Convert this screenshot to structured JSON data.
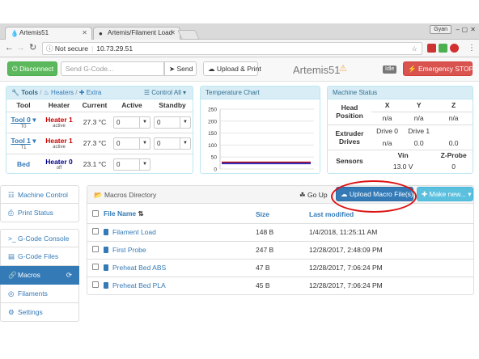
{
  "browser": {
    "tabs": [
      {
        "title": "Artemis51"
      },
      {
        "title": "Artemis/Filament Load"
      }
    ],
    "user_badge": "Gyan",
    "security_label": "Not secure",
    "url": "10.73.29.51"
  },
  "toolbar": {
    "disconnect_label": "Disconnect",
    "gcode_placeholder": "Send G-Code...",
    "send_label": "Send",
    "upload_print_label": "Upload & Print",
    "machine_name": "Artemis51",
    "status_badge": "Idle",
    "emergency_label": "Emergency STOP"
  },
  "tools_panel": {
    "tabs": {
      "tools": "Tools",
      "heaters": "Heaters",
      "extra": "Extra",
      "control_all": "Control All"
    },
    "headers": [
      "Tool",
      "Heater",
      "Current",
      "Active",
      "Standby"
    ],
    "rows": [
      {
        "tool": "Tool 0",
        "tool_sub": "T0",
        "heater": "Heater 1",
        "heater_sub": "active",
        "current": "27.3 °C",
        "active": "0",
        "standby": "0"
      },
      {
        "tool": "Tool 1",
        "tool_sub": "T1",
        "heater": "Heater 1",
        "heater_sub": "active",
        "current": "27.3 °C",
        "active": "0",
        "standby": "0"
      },
      {
        "tool": "Bed",
        "tool_sub": "",
        "heater": "Heater 0",
        "heater_sub": "off",
        "current": "23.1 °C",
        "active": "0",
        "standby": ""
      }
    ]
  },
  "temp_chart": {
    "title": "Temperature Chart",
    "yticks": [
      "250",
      "200",
      "150",
      "100",
      "50",
      "0"
    ],
    "ylim": [
      0,
      250
    ],
    "series": [
      {
        "color": "#c00000",
        "value": 27.3
      },
      {
        "color": "#3030c0",
        "value": 23.1
      }
    ]
  },
  "machine_status": {
    "title": "Machine Status",
    "head_position_label": "Head Position",
    "axes": [
      "X",
      "Y",
      "Z"
    ],
    "positions": [
      "n/a",
      "n/a",
      "n/a"
    ],
    "extruder_label": "Extruder Drives",
    "drives": [
      "Drive 0",
      "Drive 1"
    ],
    "drive_values": [
      "n/a",
      "0.0",
      "0.0"
    ],
    "sensors_label": "Sensors",
    "sensor_names": [
      "Vin",
      "Z-Probe"
    ],
    "sensor_values": [
      "13.0 V",
      "0"
    ]
  },
  "sidebar": {
    "items": [
      {
        "label": "Machine Control",
        "icon": "sliders-icon"
      },
      {
        "label": "Print Status",
        "icon": "print-icon"
      },
      {
        "label": "G-Code Console",
        "icon": "terminal-icon"
      },
      {
        "label": "G-Code Files",
        "icon": "file-icon"
      },
      {
        "label": "Macros",
        "icon": "link-icon"
      },
      {
        "label": "Filaments",
        "icon": "filament-icon"
      },
      {
        "label": "Settings",
        "icon": "gear-icon"
      }
    ]
  },
  "macros": {
    "directory_label": "Macros Directory",
    "go_up_label": "Go Up",
    "upload_label": "Upload Macro File(s)",
    "make_new_label": "Make new...",
    "columns": [
      "File Name",
      "Size",
      "Last modified"
    ],
    "rows": [
      {
        "name": "Filament Load",
        "size": "148 B",
        "modified": "1/4/2018, 11:25:11 AM"
      },
      {
        "name": "First Probe",
        "size": "247 B",
        "modified": "12/28/2017, 2:48:09 PM"
      },
      {
        "name": "Preheat Bed ABS",
        "size": "47 B",
        "modified": "12/28/2017, 7:06:24 PM"
      },
      {
        "name": "Preheat Bed PLA",
        "size": "45 B",
        "modified": "12/28/2017, 7:06:24 PM"
      }
    ]
  }
}
